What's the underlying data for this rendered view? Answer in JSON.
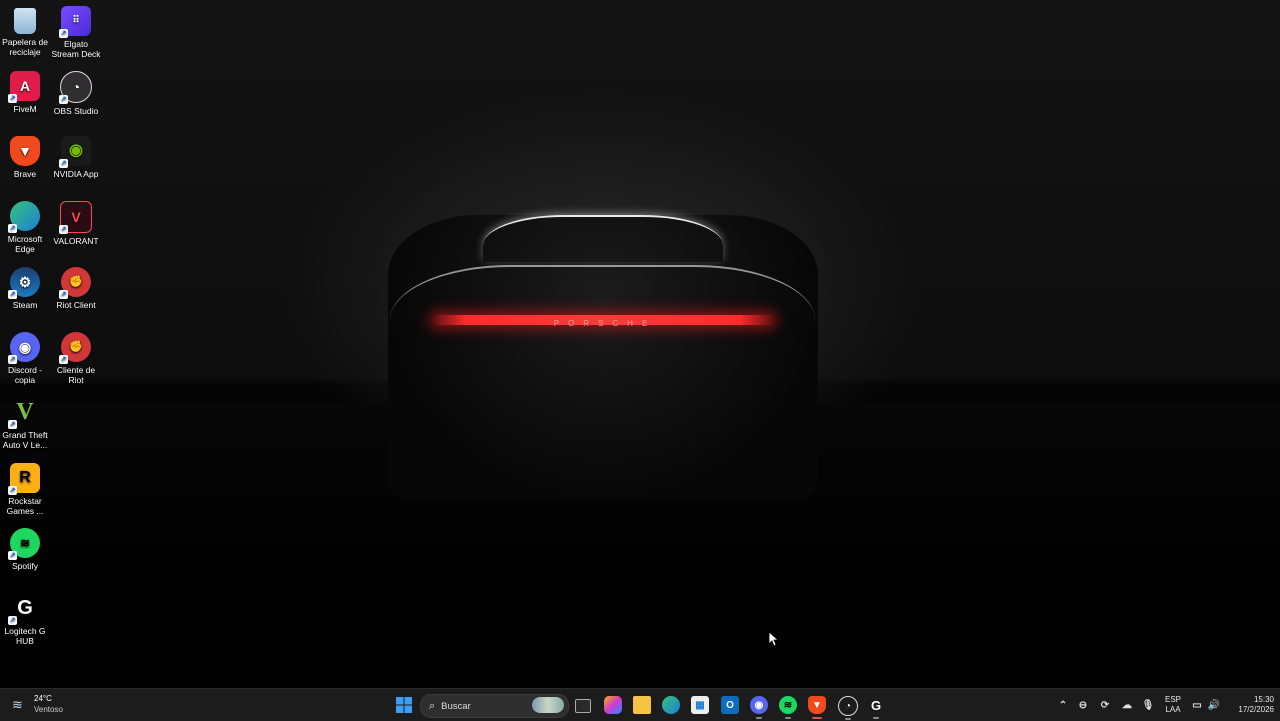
{
  "desktop": {
    "icons": [
      {
        "label": "Papelera de reciclaje",
        "icon": "recycle-bin-icon"
      },
      {
        "label": "Elgato Stream Deck",
        "icon": "stream-deck-icon"
      },
      {
        "label": "FiveM",
        "icon": "fivem-icon"
      },
      {
        "label": "OBS Studio",
        "icon": "obs-icon"
      },
      {
        "label": "Brave",
        "icon": "brave-icon"
      },
      {
        "label": "NVIDIA App",
        "icon": "nvidia-icon"
      },
      {
        "label": "Microsoft Edge",
        "icon": "edge-icon"
      },
      {
        "label": "VALORANT",
        "icon": "valorant-icon"
      },
      {
        "label": "Steam",
        "icon": "steam-icon"
      },
      {
        "label": "Riot Client",
        "icon": "riot-icon"
      },
      {
        "label": "Discord - copia",
        "icon": "discord-icon"
      },
      {
        "label": "Cliente de Riot",
        "icon": "riot-icon"
      },
      {
        "label": "Grand Theft Auto V Le...",
        "icon": "gta-icon"
      },
      {
        "label": "Rockstar Games ...",
        "icon": "rockstar-icon"
      },
      {
        "label": "Spotify",
        "icon": "spotify-icon"
      },
      {
        "label": "Logitech G HUB",
        "icon": "logitech-icon"
      }
    ],
    "wallpaper_text": "PORSCHE"
  },
  "taskbar": {
    "weather": {
      "temp": "24°C",
      "condition": "Ventoso"
    },
    "search_placeholder": "Buscar",
    "language": {
      "top": "ESP",
      "bottom": "LAA"
    },
    "clock": {
      "time": "15:30",
      "date": "17/2/2026"
    },
    "accent_color": "#e05050"
  }
}
